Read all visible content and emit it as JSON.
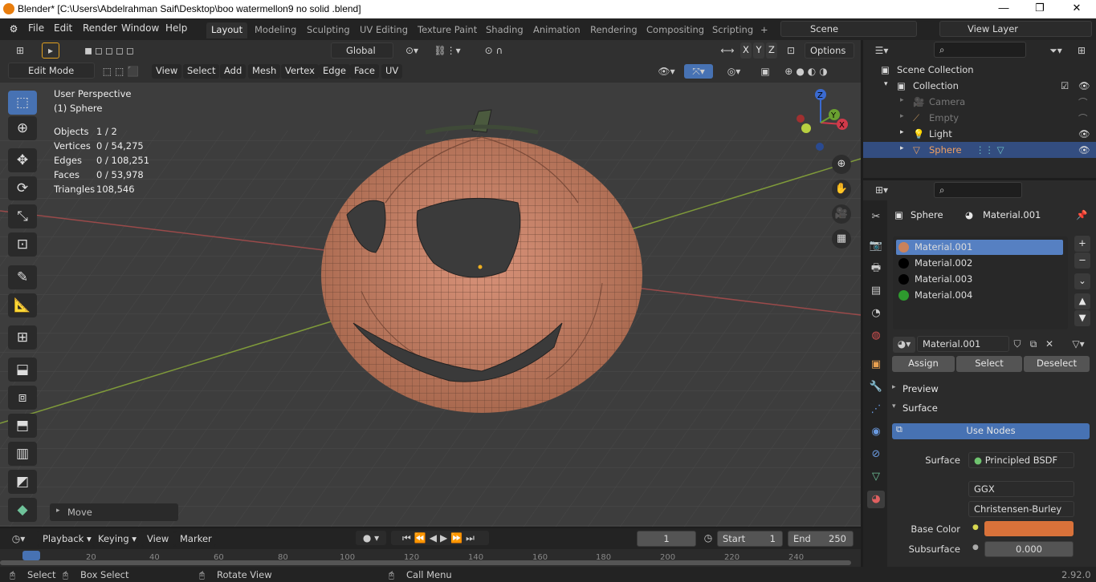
{
  "window": {
    "title": "Blender* [C:\\Users\\Abdelrahman Saif\\Desktop\\boo watermellon9 no solid .blend]",
    "min": "—",
    "max": "❐",
    "close": "✕"
  },
  "menus": [
    "File",
    "Edit",
    "Render",
    "Window",
    "Help"
  ],
  "workspaces": [
    "Layout",
    "Modeling",
    "Sculpting",
    "UV Editing",
    "Texture Paint",
    "Shading",
    "Animation",
    "Rendering",
    "Compositing",
    "Scripting"
  ],
  "add_workspace": "+",
  "scene": {
    "name": "Scene",
    "view_layer": "View Layer"
  },
  "viewport_header": {
    "mode": "Edit Mode",
    "menus": [
      "View",
      "Select",
      "Add",
      "Mesh",
      "Vertex",
      "Edge",
      "Face",
      "UV"
    ],
    "transform_orientation": "Global",
    "axes": [
      "X",
      "Y",
      "Z"
    ],
    "options": "Options"
  },
  "overlay_text": {
    "perspective": "User Perspective",
    "object": "(1) Sphere"
  },
  "stats": [
    {
      "label": "Objects",
      "value": "1 / 2"
    },
    {
      "label": "Vertices",
      "value": "0 / 54,275"
    },
    {
      "label": "Edges",
      "value": "0 / 108,251"
    },
    {
      "label": "Faces",
      "value": "0 / 53,978"
    },
    {
      "label": "Triangles",
      "value": "108,546"
    }
  ],
  "last_op": "Move",
  "gizmo": {
    "x": "X",
    "y": "Y",
    "z": "Z"
  },
  "outliner": {
    "root": "Scene Collection",
    "collection": "Collection",
    "items": [
      {
        "name": "Camera",
        "selected": false
      },
      {
        "name": "Empty",
        "selected": false
      },
      {
        "name": "Light",
        "selected": false
      },
      {
        "name": "Sphere",
        "selected": true
      }
    ]
  },
  "properties": {
    "breadcrumb_object": "Sphere",
    "breadcrumb_material": "Material.001",
    "material_slots": [
      {
        "name": "Material.001",
        "color": "#c9825c",
        "selected": true
      },
      {
        "name": "Material.002",
        "color": "#000000",
        "selected": false
      },
      {
        "name": "Material.003",
        "color": "#000000",
        "selected": false
      },
      {
        "name": "Material.004",
        "color": "#2e9a2e",
        "selected": false
      }
    ],
    "active_material": "Material.001",
    "assign": "Assign",
    "select": "Select",
    "deselect": "Deselect",
    "preview_panel": "Preview",
    "surface_panel": "Surface",
    "use_nodes": "Use Nodes",
    "surface_label": "Surface",
    "surface_value": "Principled BSDF",
    "distribution": "GGX",
    "subsurface_method": "Christensen-Burley",
    "base_color_label": "Base Color",
    "base_color": "#d9723a",
    "subsurface_label": "Subsurface",
    "subsurface_value": "0.000"
  },
  "timeline": {
    "menus": [
      "Playback",
      "Keying",
      "View",
      "Marker"
    ],
    "current_frame": "1",
    "start_label": "Start",
    "start": "1",
    "end_label": "End",
    "end": "250",
    "ticks": [
      "20",
      "40",
      "60",
      "80",
      "100",
      "120",
      "140",
      "160",
      "180",
      "200",
      "220",
      "240"
    ]
  },
  "statusbar": {
    "select": "Select",
    "box_select": "Box Select",
    "rotate_view": "Rotate View",
    "call_menu": "Call Menu",
    "version": "2.92.0"
  }
}
